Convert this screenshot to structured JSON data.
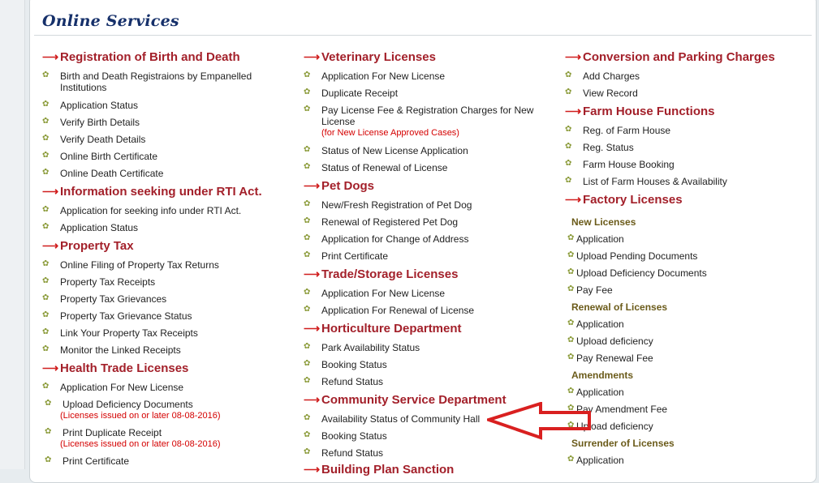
{
  "page_title": "Online Services",
  "colors": {
    "heading": "#a3202a",
    "title": "#16306a",
    "note": "#d40000",
    "annotation_arrow": "#d92020"
  },
  "col1": {
    "birth_death": {
      "heading": "Registration of Birth and Death",
      "items": [
        "Birth and Death Registraions by Empanelled",
        "Institutions",
        "Application Status",
        "Verify Birth Details",
        "Verify Death Details",
        "Online Birth Certificate",
        "Online Death Certificate"
      ]
    },
    "rti": {
      "heading": "Information seeking under RTI Act.",
      "items": [
        "Application for seeking info under RTI Act.",
        "Application Status"
      ]
    },
    "property": {
      "heading": "Property Tax",
      "items": [
        "Online Filing of Property Tax Returns",
        "Property Tax Receipts",
        "Property Tax Grievances",
        "Property Tax Grievance Status",
        "Link Your Property Tax Receipts",
        "Monitor the Linked Receipts"
      ]
    },
    "health": {
      "heading": "Health Trade Licenses",
      "items": [
        "Application For New License",
        "Upload Deficiency Documents",
        "Print Duplicate Receipt",
        "Print Certificate"
      ],
      "note": "(Licenses issued on or later 08-08-2016)"
    }
  },
  "col2": {
    "vet": {
      "heading": "Veterinary Licenses",
      "items": [
        "Application For New License",
        "Duplicate Receipt",
        "Pay License Fee & Registration Charges for New",
        "License",
        "Status of New License Application",
        "Status of Renewal of License"
      ],
      "note": "(for New License Approved Cases)"
    },
    "pet": {
      "heading": "Pet Dogs",
      "items": [
        "New/Fresh Registration of Pet Dog",
        "Renewal of Registered Pet Dog",
        "Application for Change of Address",
        "Print Certificate"
      ]
    },
    "trade": {
      "heading": "Trade/Storage Licenses",
      "items": [
        "Application For New License",
        "Application For Renewal of License"
      ]
    },
    "horti": {
      "heading": "Horticulture Department",
      "items": [
        "Park Availability Status",
        "Booking Status",
        "Refund Status"
      ]
    },
    "community": {
      "heading": "Community Service Department",
      "items": [
        "Availability Status of Community Hall",
        "Booking Status",
        "Refund Status"
      ]
    },
    "building": {
      "heading": "Building Plan Sanction"
    }
  },
  "col3": {
    "conversion": {
      "heading": "Conversion and Parking Charges",
      "items": [
        "Add Charges",
        "View Record"
      ]
    },
    "farm": {
      "heading": "Farm House Functions",
      "items": [
        "Reg. of Farm House",
        "Reg. Status",
        "Farm House Booking",
        "List of Farm Houses & Availability"
      ]
    },
    "factory": {
      "heading": "Factory Licenses",
      "new_label": "New Licenses",
      "new_items": [
        "Application",
        "Upload Pending Documents",
        "Upload Deficiency Documents",
        "Pay Fee"
      ],
      "renewal_label": "Renewal of Licenses",
      "renewal_items": [
        "Application",
        "Upload deficiency",
        "Pay Renewal Fee"
      ],
      "amend_label": "Amendments",
      "amend_items": [
        "Application",
        "Pay Amendment Fee",
        "Upload deficiency"
      ],
      "surrender_label": "Surrender of Licenses",
      "surrender_items": [
        "Application"
      ]
    }
  }
}
